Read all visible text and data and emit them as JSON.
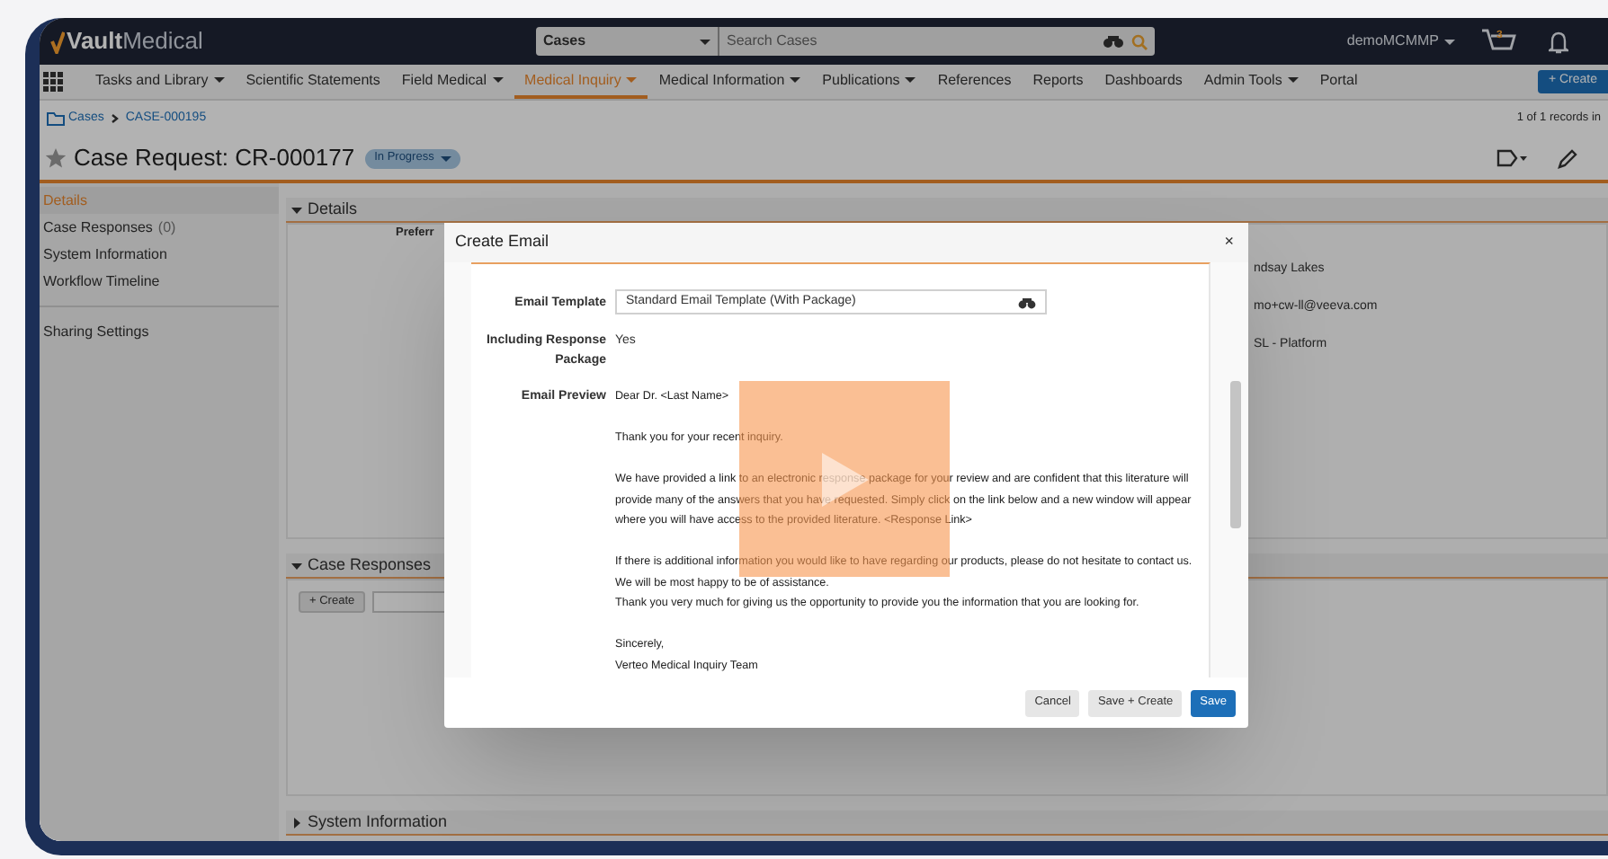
{
  "topbar": {
    "logo_bold": "Vault",
    "logo_light": "Medical",
    "search_object": "Cases",
    "search_placeholder": "Search Cases",
    "user": "demoMCMMP",
    "cart_count": "3"
  },
  "nav": [
    {
      "label": "Tasks and Library",
      "dropdown": true,
      "selected": false
    },
    {
      "label": "Scientific Statements",
      "dropdown": false,
      "selected": false
    },
    {
      "label": "Field Medical",
      "dropdown": true,
      "selected": false
    },
    {
      "label": "Medical Inquiry",
      "dropdown": true,
      "selected": true
    },
    {
      "label": "Medical Information",
      "dropdown": true,
      "selected": false
    },
    {
      "label": "Publications",
      "dropdown": true,
      "selected": false
    },
    {
      "label": "References",
      "dropdown": false,
      "selected": false
    },
    {
      "label": "Reports",
      "dropdown": false,
      "selected": false
    },
    {
      "label": "Dashboards",
      "dropdown": false,
      "selected": false
    },
    {
      "label": "Admin Tools",
      "dropdown": true,
      "selected": false
    },
    {
      "label": "Portal",
      "dropdown": false,
      "selected": false
    }
  ],
  "create_button": "+ Create",
  "breadcrumb": [
    "Cases",
    "CASE-000195"
  ],
  "records": "1 of 1 records in",
  "title": "Case Request: CR-000177",
  "status": "In Progress",
  "sidebar": [
    [
      {
        "label": "Details",
        "selected": true
      },
      {
        "label": "Case Responses",
        "count": "(0)",
        "selected": false
      },
      {
        "label": "System Information",
        "selected": false
      },
      {
        "label": "Workflow Timeline",
        "selected": false
      }
    ],
    [
      {
        "label": "Sharing Settings",
        "selected": false
      }
    ]
  ],
  "sections": [
    {
      "title": "Details",
      "expanded": true,
      "kind": "details",
      "left_labels": [
        "Preferr"
      ],
      "right_values": [
        "ndsay Lakes",
        "mo+cw-ll@veeva.com",
        "SL - Platform"
      ]
    },
    {
      "title": "Case Responses",
      "expanded": true,
      "kind": "responses",
      "button": "+ Create"
    },
    {
      "title": "System Information",
      "expanded": false,
      "kind": "collapsed"
    }
  ],
  "modal": {
    "title": "Create Email",
    "close": "×",
    "fields": [
      {
        "kind": "lookup",
        "label": "Email Template",
        "value": "Standard Email Template (With Package)"
      },
      {
        "kind": "text",
        "label": "Including Response Package",
        "value": "Yes"
      },
      {
        "kind": "preview",
        "label": "Email Preview",
        "paragraphs": [
          [
            "Dear Dr. <Last Name>"
          ],
          [
            "Thank you for your recent inquiry."
          ],
          [
            "We have provided a link to an electronic response package for your review and are confident that this literature will",
            "provide many of the answers that you have requested. Simply click on the link below and a new window will appear",
            "where you will have access to the provided literature. <Response Link>"
          ],
          [
            "If there is additional information you would like to have regarding our products, please do not hesitate to contact us.",
            "We will be most happy to be of assistance.",
            "Thank you very much for giving us the opportunity to provide you the information that you are looking for."
          ],
          [
            "Sincerely,",
            "Verteo Medical Inquiry Team"
          ]
        ]
      }
    ],
    "buttons": [
      {
        "label": "Cancel",
        "primary": false
      },
      {
        "label": "Save + Create",
        "primary": false
      },
      {
        "label": "Save",
        "primary": true
      }
    ]
  }
}
